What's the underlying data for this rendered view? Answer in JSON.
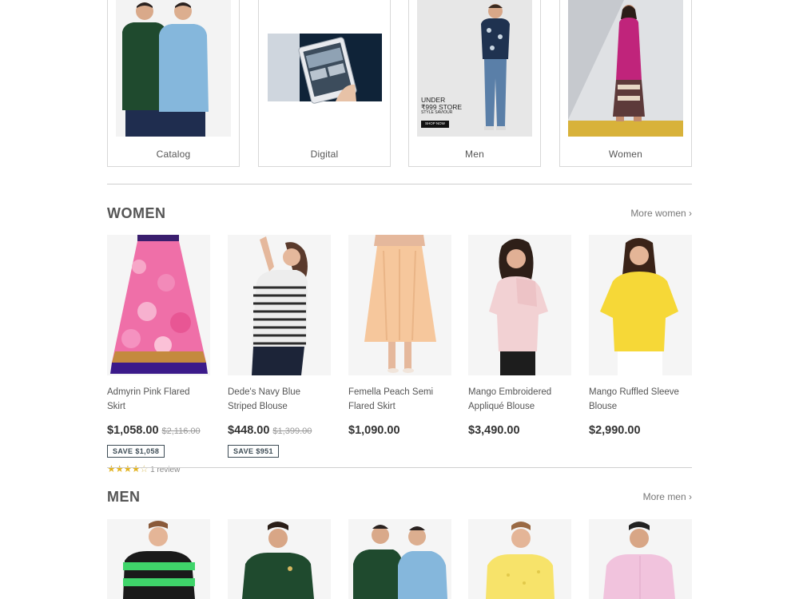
{
  "collections": [
    {
      "label": "Catalog",
      "image": "two-men-polo-shirts"
    },
    {
      "label": "Digital",
      "image": "tablet-in-hand"
    },
    {
      "label": "Men",
      "image": "men-store-banner",
      "banner": {
        "line1": "UNDER",
        "line2": "₹999 STORE",
        "line3": "STYLE SAVIOUR",
        "cta": "SHOP NOW"
      }
    },
    {
      "label": "Women",
      "image": "woman-pink-kurta"
    }
  ],
  "women": {
    "title": "WOMEN",
    "more": "More women ›",
    "products": [
      {
        "name": "Admyrin Pink Flared Skirt",
        "price": "$1,058.00",
        "compare": "$2,116.00",
        "save": "SAVE $1,058",
        "rating_stars": 4,
        "reviews": "1 review"
      },
      {
        "name": "Dede's Navy Blue Striped Blouse",
        "price": "$448.00",
        "compare": "$1,399.00",
        "save": "SAVE $951"
      },
      {
        "name": "Femella Peach Semi Flared Skirt",
        "price": "$1,090.00"
      },
      {
        "name": "Mango Embroidered Appliqué Blouse",
        "price": "$3,490.00"
      },
      {
        "name": "Mango Ruffled Sleeve Blouse",
        "price": "$2,990.00"
      }
    ]
  },
  "men": {
    "title": "MEN",
    "more": "More men ›"
  },
  "colors": {
    "accent": "#3d4c55",
    "star": "#e2b320"
  }
}
